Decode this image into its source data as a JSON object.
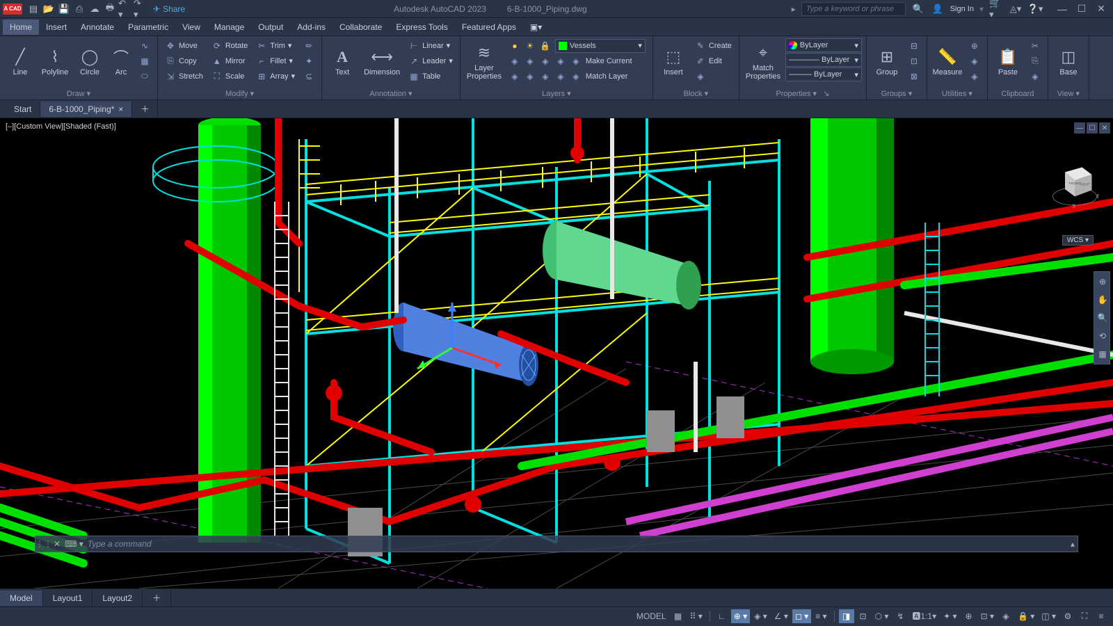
{
  "app": {
    "logo": "A CAD",
    "title": "Autodesk AutoCAD 2023",
    "doc": "6-B-1000_Piping.dwg"
  },
  "search": {
    "placeholder": "Type a keyword or phrase"
  },
  "auth": {
    "signin": "Sign In"
  },
  "share": "Share",
  "menu": [
    "Home",
    "Insert",
    "Annotate",
    "Parametric",
    "View",
    "Manage",
    "Output",
    "Add-ins",
    "Collaborate",
    "Express Tools",
    "Featured Apps"
  ],
  "ribbon": {
    "draw": {
      "label": "Draw",
      "line": "Line",
      "polyline": "Polyline",
      "circle": "Circle",
      "arc": "Arc"
    },
    "modify": {
      "label": "Modify",
      "move": "Move",
      "rotate": "Rotate",
      "trim": "Trim",
      "copy": "Copy",
      "mirror": "Mirror",
      "fillet": "Fillet",
      "stretch": "Stretch",
      "scale": "Scale",
      "array": "Array"
    },
    "annot": {
      "label": "Annotation",
      "text": "Text",
      "dim": "Dimension",
      "leader": "Leader",
      "table": "Table",
      "linear": "Linear"
    },
    "layers": {
      "label": "Layers",
      "props": "Layer\nProperties",
      "current": "Vessels",
      "mkcurrent": "Make Current",
      "matchlayer": "Match Layer"
    },
    "block": {
      "label": "Block",
      "insert": "Insert",
      "create": "Create",
      "edit": "Edit"
    },
    "props": {
      "label": "Properties",
      "match": "Match\nProperties",
      "bylayer": "ByLayer"
    },
    "groups": {
      "label": "Groups",
      "group": "Group"
    },
    "utils": {
      "label": "Utilities",
      "measure": "Measure"
    },
    "clip": {
      "label": "Clipboard",
      "paste": "Paste"
    },
    "view": {
      "label": "View",
      "base": "Base"
    }
  },
  "tabs": {
    "start": "Start",
    "file": "6-B-1000_Piping*"
  },
  "viewport": {
    "label": "[–][Custom View][Shaded (Fast)]",
    "wcs": "WCS",
    "front": "FRONT",
    "right": "RIGHT"
  },
  "cmd": {
    "placeholder": "Type a command"
  },
  "layouts": [
    "Model",
    "Layout1",
    "Layout2"
  ],
  "status": {
    "model": "MODEL",
    "scale": "1:1"
  }
}
